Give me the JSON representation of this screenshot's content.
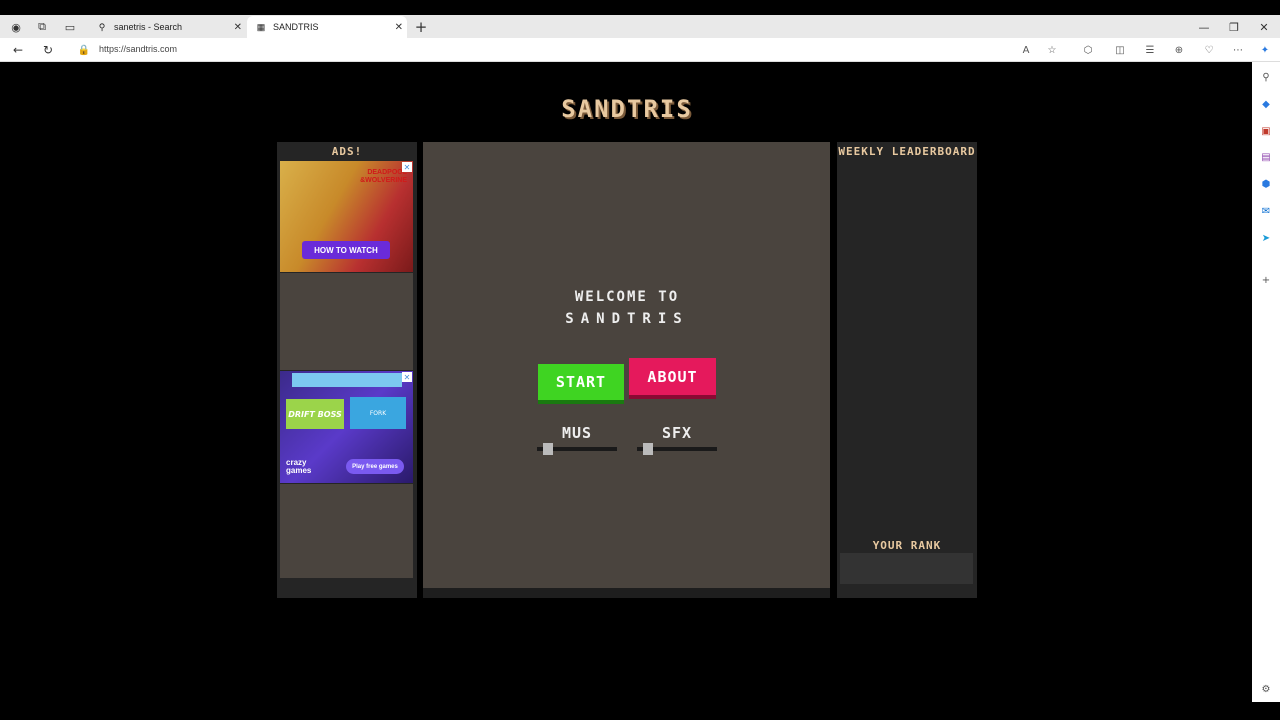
{
  "browser": {
    "tabs": [
      {
        "title": "sanetris - Search",
        "icon": "search-icon"
      },
      {
        "title": "SANDTRIS",
        "icon": "site-icon"
      }
    ],
    "new_tab": "+",
    "url": "https://sandtris.com"
  },
  "game": {
    "logo": "SANDTRIS",
    "ads_label": "ADS!",
    "ad1": {
      "title_line1": "DEADPOOL",
      "title_line2": "&WOLVERINE",
      "button": "HOW TO WATCH"
    },
    "ad2": {
      "game1": "DRIFT BOSS",
      "game2": "FORK",
      "brand_line1": "crazy",
      "brand_line2": "games",
      "cta": "Play free games"
    },
    "welcome_line1": "WELCOME TO",
    "welcome_line2": "SANDTRIS",
    "start_label": "START",
    "about_label": "ABOUT",
    "music_label": "MUS",
    "sfx_label": "SFX",
    "music_level": 0.05,
    "sfx_level": 0.05,
    "leaderboard_title": "WEEKLY LEADERBOARD",
    "your_rank_label": "YOUR RANK"
  }
}
